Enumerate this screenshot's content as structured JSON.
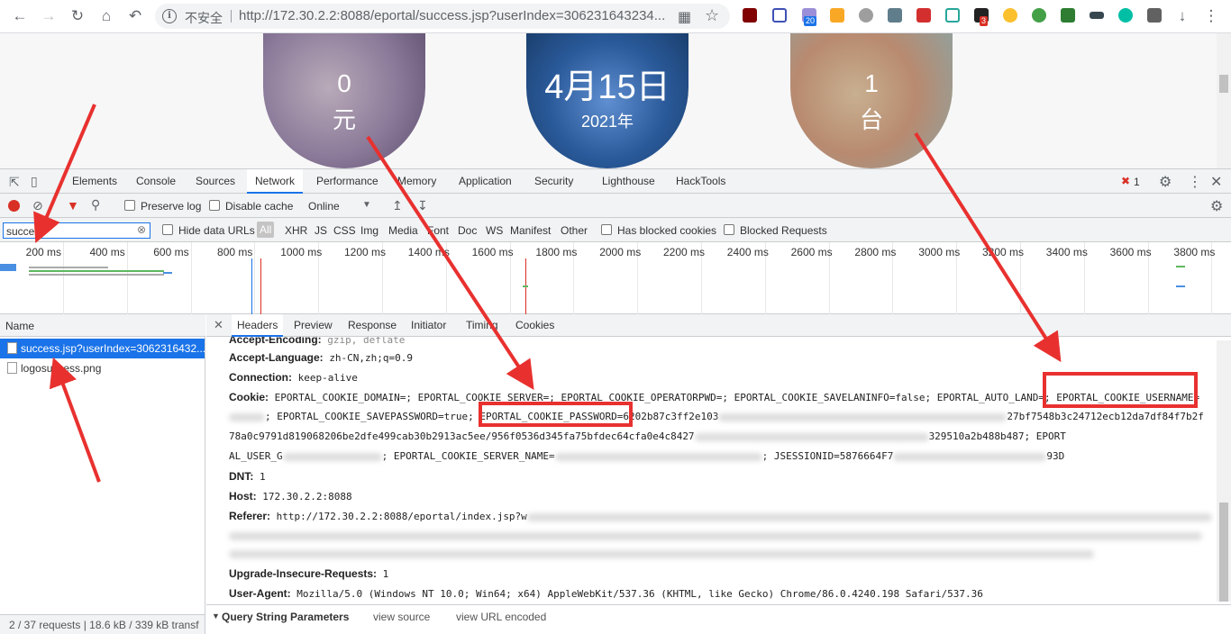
{
  "browser": {
    "insecure_label": "不安全",
    "url": "http://172.30.2.2:8088/eportal/success.jsp?userIndex=306231643234...",
    "ext_badge_1": "20",
    "ext_badge_2": "3"
  },
  "page": {
    "circle1_value": "0",
    "circle1_unit": "元",
    "circle2_value": "4月15日",
    "circle2_year": "2021年",
    "circle3_value": "1",
    "circle3_unit": "台"
  },
  "devtools": {
    "tabs": [
      "Elements",
      "Console",
      "Sources",
      "Network",
      "Performance",
      "Memory",
      "Application",
      "Security",
      "Lighthouse",
      "HackTools"
    ],
    "error_count": "1",
    "toolbar": {
      "preserve_log": "Preserve log",
      "disable_cache": "Disable cache",
      "throttle": "Online"
    },
    "filter_value": "success",
    "filters": {
      "hide_data_urls": "Hide data URLs",
      "types": [
        "All",
        "XHR",
        "JS",
        "CSS",
        "Img",
        "Media",
        "Font",
        "Doc",
        "WS",
        "Manifest",
        "Other"
      ],
      "has_blocked": "Has blocked cookies",
      "blocked_requests": "Blocked Requests"
    },
    "timeline_ticks": [
      "200 ms",
      "400 ms",
      "600 ms",
      "800 ms",
      "1000 ms",
      "1200 ms",
      "1400 ms",
      "1600 ms",
      "1800 ms",
      "2000 ms",
      "2200 ms",
      "2400 ms",
      "2600 ms",
      "2800 ms",
      "3000 ms",
      "3200 ms",
      "3400 ms",
      "3600 ms",
      "3800 ms"
    ],
    "requests": {
      "header": "Name",
      "items": [
        "success.jsp?userIndex=3062316432...",
        "logosuccess.png"
      ],
      "footer": "2 / 37 requests  |  18.6 kB / 339 kB transf"
    },
    "detail": {
      "tabs": [
        "Headers",
        "Preview",
        "Response",
        "Initiator",
        "Timing",
        "Cookies"
      ],
      "headers": {
        "accept_encoding_key": "Accept-Encoding:",
        "accept_encoding_val": "gzip, deflate",
        "accept_language_key": "Accept-Language:",
        "accept_language_val": "zh-CN,zh;q=0.9",
        "connection_key": "Connection:",
        "connection_val": "keep-alive",
        "cookie_key": "Cookie:",
        "cookie_line1": "EPORTAL_COOKIE_DOMAIN=; EPORTAL_COOKIE_SERVER=; EPORTAL_COOKIE_OPERATORPWD=; EPORTAL_COOKIE_SAVELANINFO=false; EPORTAL_AUTO_LAND=; EPORTAL_COOKIE_USERNAME=",
        "cookie_line2a": "; EPORTAL_COOKIE_SAVEPASSWORD=true; EPORTAL_COOKIE_PASSWORD=",
        "cookie_line2b": "6202b87c3ff2e103",
        "cookie_line2c": "27bf7548b3c24712ecb12da7df84f7b2f",
        "cookie_line3a": "78a0c9791d819068206be2dfe499cab30b2913ac5ee/956f0536d345fa75bfdec64cfa0e4c8427",
        "cookie_line3b": "329510a2b488b487; EPORT",
        "cookie_line4a": "AL_USER_G",
        "cookie_line4b": "; EPORTAL_COOKIE_SERVER_NAME=",
        "cookie_line4c": "; JSESSIONID=5876664F7",
        "cookie_line4d": "93D",
        "dnt_key": "DNT:",
        "dnt_val": "1",
        "host_key": "Host:",
        "host_val": "172.30.2.2:8088",
        "referer_key": "Referer:",
        "referer_val": "http://172.30.2.2:8088/eportal/index.jsp?w",
        "uir_key": "Upgrade-Insecure-Requests:",
        "uir_val": "1",
        "ua_key": "User-Agent:",
        "ua_val": "Mozilla/5.0 (Windows NT 10.0; Win64; x64) AppleWebKit/537.36 (KHTML, like Gecko) Chrome/86.0.4240.198 Safari/537.36"
      },
      "query_section": "Query String Parameters",
      "view_source": "view source",
      "view_url_encoded": "view URL encoded"
    }
  },
  "annotations": {
    "box_password": "EPORTAL_COOKIE_PASSWORD=",
    "box_username": "EPORTAL_COOKIE_USERNAME=",
    "color": "#e8312f"
  }
}
